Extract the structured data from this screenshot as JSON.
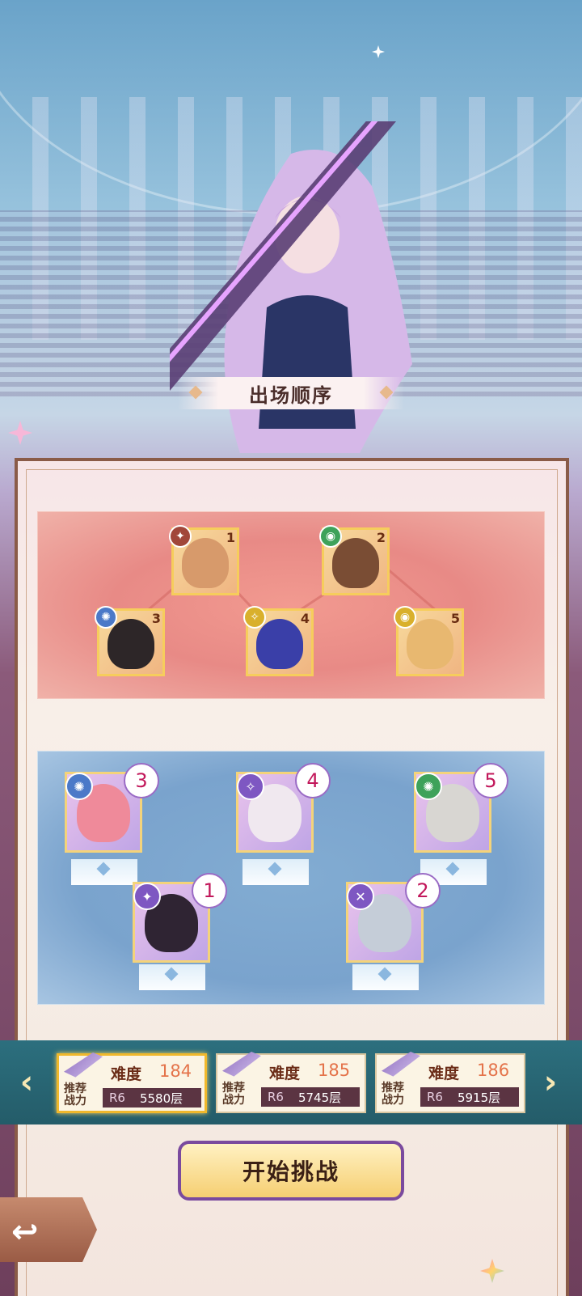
{
  "header": {
    "title": "出场顺序"
  },
  "enemy_team": [
    {
      "slot": "1",
      "class_icon": "ranger-icon",
      "class_color": "#a1473a",
      "face_color": "#d79a6b"
    },
    {
      "slot": "2",
      "class_icon": "mage-icon",
      "class_color": "#3ea25a",
      "face_color": "#7a4d34"
    },
    {
      "slot": "3",
      "class_icon": "assassin-icon",
      "class_color": "#4b79c8",
      "face_color": "#2d2628"
    },
    {
      "slot": "4",
      "class_icon": "cleric-icon",
      "class_color": "#d9b02c",
      "face_color": "#3a3fa8"
    },
    {
      "slot": "5",
      "class_icon": "mage-icon",
      "class_color": "#d9b02c",
      "face_color": "#e8b870"
    }
  ],
  "ally_team": [
    {
      "order": "3",
      "class_icon": "assassin-icon",
      "class_color": "#4b79c8",
      "face_color": "#ef8a9a"
    },
    {
      "order": "4",
      "class_icon": "cleric-icon",
      "class_color": "#7e57c2",
      "face_color": "#f0e8ef"
    },
    {
      "order": "5",
      "class_icon": "assassin-icon",
      "class_color": "#3ea25a",
      "face_color": "#d8d6d2"
    },
    {
      "order": "1",
      "class_icon": "ranger-icon",
      "class_color": "#7e57c2",
      "face_color": "#2f2433"
    },
    {
      "order": "2",
      "class_icon": "warrior-icon",
      "class_color": "#7e57c2",
      "face_color": "#c5cdd8"
    }
  ],
  "stages": [
    {
      "recommend_label": "推荐\n战力",
      "difficulty_label": "难度",
      "difficulty": "184",
      "rank": "R6",
      "floor": "5580层",
      "selected": true
    },
    {
      "recommend_label": "推荐\n战力",
      "difficulty_label": "难度",
      "difficulty": "185",
      "rank": "R6",
      "floor": "5745层",
      "selected": false
    },
    {
      "recommend_label": "推荐\n战力",
      "difficulty_label": "难度",
      "difficulty": "186",
      "rank": "R6",
      "floor": "5915层",
      "selected": false
    }
  ],
  "buttons": {
    "start": "开始挑战",
    "prev": "‹",
    "next": "›",
    "back": "↩"
  }
}
